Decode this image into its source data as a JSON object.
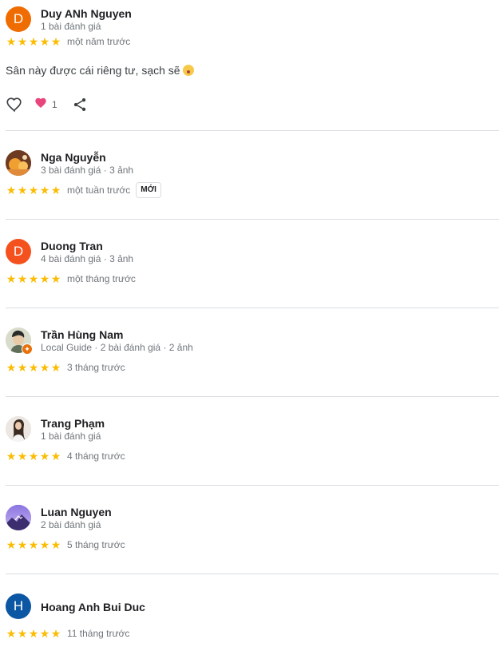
{
  "reviews": [
    {
      "name": "Duy ANh Nguyen",
      "meta": "1 bài đánh giá",
      "avatar_letter": "D",
      "avatar_color": "#ef6c00",
      "stars": 5,
      "date": "một năm trước",
      "text": "Sân này được cái riêng tư, sạch sẽ",
      "reaction_count": "1"
    },
    {
      "name": "Nga Nguyễn",
      "meta": "3 bài đánh giá · 3 ảnh",
      "stars": 5,
      "date": "một tuần trước",
      "badge": "MỚI"
    },
    {
      "name": "Duong Tran",
      "meta": "4 bài đánh giá · 3 ảnh",
      "avatar_letter": "D",
      "avatar_color": "#f4511e",
      "stars": 5,
      "date": "một tháng trước"
    },
    {
      "name": "Trần Hùng Nam",
      "meta": "Local Guide · 2 bài đánh giá · 2 ảnh",
      "stars": 5,
      "date": "3 tháng trước"
    },
    {
      "name": "Trang Phạm",
      "meta": "1 bài đánh giá",
      "stars": 5,
      "date": "4 tháng trước"
    },
    {
      "name": "Luan Nguyen",
      "meta": "2 bài đánh giá",
      "stars": 5,
      "date": "5 tháng trước"
    },
    {
      "name": "Hoang Anh Bui Duc",
      "avatar_letter": "H",
      "avatar_color": "#0b57a4",
      "stars": 5,
      "date": "11 tháng trước"
    }
  ]
}
